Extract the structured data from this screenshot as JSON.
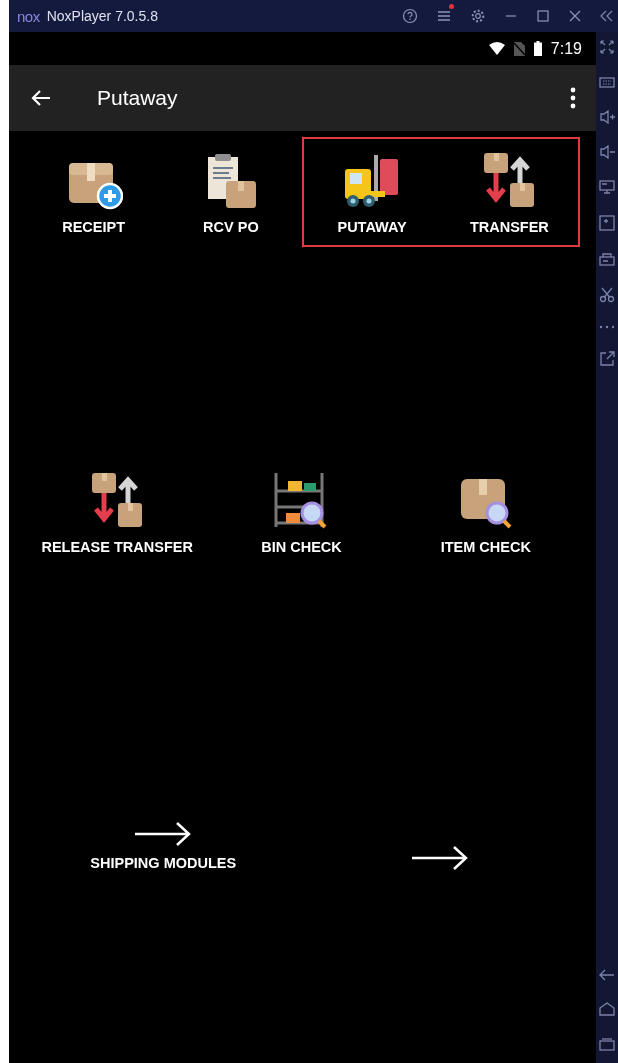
{
  "window": {
    "logo": "nox",
    "title": "NoxPlayer 7.0.5.8",
    "notification": true
  },
  "status_bar": {
    "time": "7:19"
  },
  "app_bar": {
    "title": "Putaway"
  },
  "module_rows": [
    {
      "items": [
        {
          "label": "RECEIPT",
          "kind": "box-plus",
          "highlighted": false
        },
        {
          "label": "RCV PO",
          "kind": "clipboard-box",
          "highlighted": false
        },
        {
          "label": "PUTAWAY",
          "kind": "forklift",
          "highlighted": true
        },
        {
          "label": "TRANSFER",
          "kind": "transfer",
          "highlighted": true
        }
      ]
    },
    {
      "items": [
        {
          "label": "RELEASE TRANSFER",
          "kind": "transfer",
          "highlighted": false
        },
        {
          "label": "BIN CHECK",
          "kind": "shelf-search",
          "highlighted": false
        },
        {
          "label": "ITEM CHECK",
          "kind": "box-search",
          "highlighted": false
        }
      ]
    },
    {
      "items": [
        {
          "label": "SHIPPING MODULES",
          "kind": "arrow",
          "highlighted": false
        },
        {
          "kind": "arrow",
          "highlighted": false
        }
      ]
    }
  ]
}
